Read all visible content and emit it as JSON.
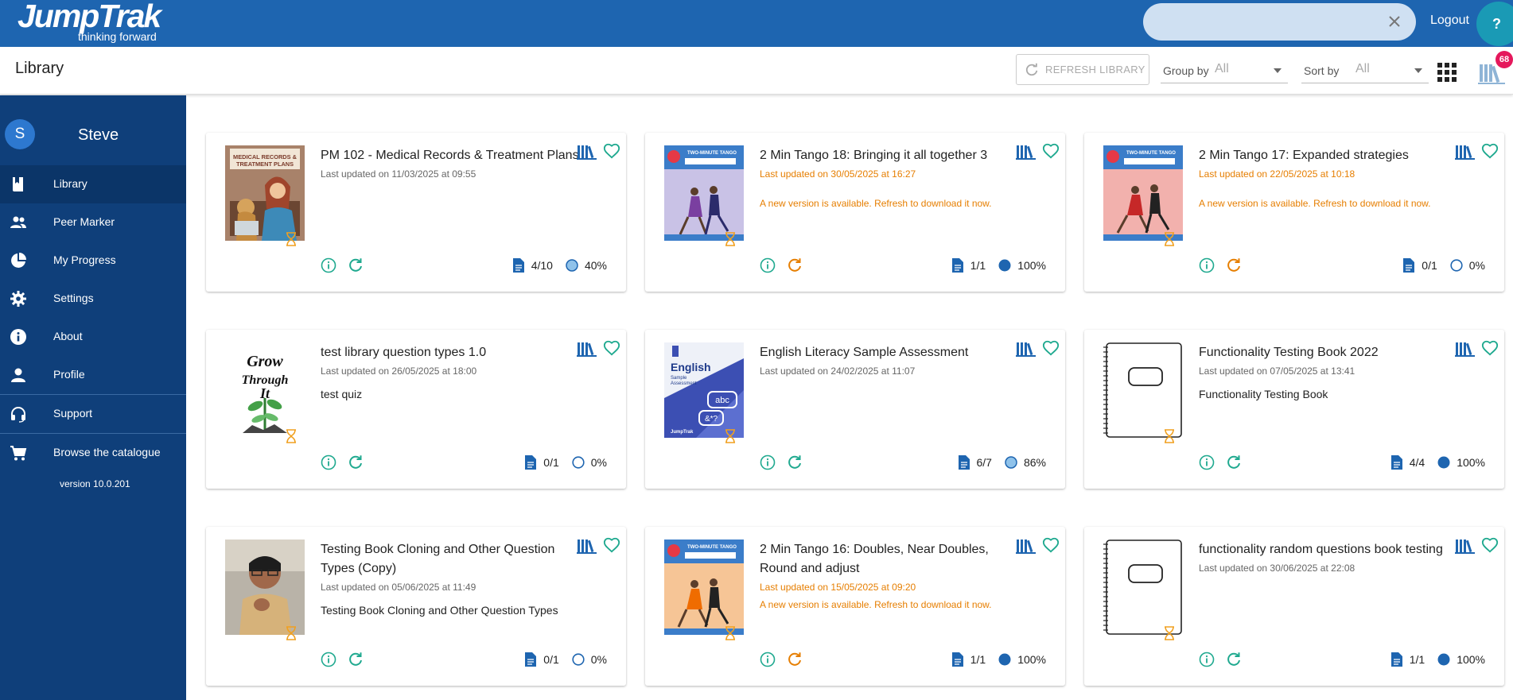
{
  "app": {
    "logo_main": "JumpTrak",
    "logo_sub": "thinking forward",
    "search_placeholder": "",
    "logout_label": "Logout",
    "help_label": "?"
  },
  "header": {
    "title": "Library",
    "refresh_label": "REFRESH LIBRARY",
    "group_by_label": "Group by",
    "group_by_value": "All",
    "sort_by_label": "Sort by",
    "sort_by_value": "All",
    "badge_count": "68"
  },
  "sidebar": {
    "avatar_initial": "S",
    "user_name": "Steve",
    "items": [
      {
        "label": "Library",
        "icon": "book-icon"
      },
      {
        "label": "Peer Marker",
        "icon": "people-icon"
      },
      {
        "label": "My Progress",
        "icon": "pie-chart-icon"
      },
      {
        "label": "Settings",
        "icon": "gear-icon"
      },
      {
        "label": "About",
        "icon": "info-icon"
      },
      {
        "label": "Profile",
        "icon": "person-icon"
      },
      {
        "label": "Support",
        "icon": "headset-icon"
      },
      {
        "label": "Browse the catalogue",
        "icon": "cart-icon"
      }
    ],
    "version": "version 10.0.201"
  },
  "colors": {
    "brand_blue": "#1e65b0",
    "sidebar_bg": "#0f3f7a",
    "accent_teal": "#1fa98f",
    "warning_orange": "#e67e00",
    "badge_pink": "#e5185c"
  },
  "cards": [
    {
      "title": "PM 102 - Medical Records & Treatment Plans",
      "date": "Last updated on 11/03/2025 at 09:55",
      "date_warning": false,
      "description": "",
      "new_version": "",
      "pages": "4/10",
      "progress": "40%",
      "progress_fraction": 0.4
    },
    {
      "title": "2 Min Tango 18: Bringing it all together 3",
      "date": "Last updated on 30/05/2025 at 16:27",
      "date_warning": true,
      "description": "",
      "new_version": "A new version is available. Refresh to download it now.",
      "pages": "1/1",
      "progress": "100%",
      "progress_fraction": 1.0
    },
    {
      "title": "2 Min Tango 17: Expanded strategies",
      "date": "Last updated on 22/05/2025 at 10:18",
      "date_warning": true,
      "description": "",
      "new_version": "A new version is available. Refresh to download it now.",
      "pages": "0/1",
      "progress": "0%",
      "progress_fraction": 0.0
    },
    {
      "title": "test library question types 1.0",
      "date": "Last updated on 26/05/2025 at 18:00",
      "date_warning": false,
      "description": "test quiz",
      "new_version": "",
      "pages": "0/1",
      "progress": "0%",
      "progress_fraction": 0.0
    },
    {
      "title": "English Literacy Sample Assessment",
      "date": "Last updated on 24/02/2025 at 11:07",
      "date_warning": false,
      "description": "",
      "new_version": "",
      "pages": "6/7",
      "progress": "86%",
      "progress_fraction": 0.86
    },
    {
      "title": "Functionality Testing Book 2022",
      "date": "Last updated on 07/05/2025 at 13:41",
      "date_warning": false,
      "description": "Functionality Testing Book",
      "new_version": "",
      "pages": "4/4",
      "progress": "100%",
      "progress_fraction": 1.0
    },
    {
      "title": "Testing Book Cloning and Other Question Types (Copy)",
      "date": "Last updated on 05/06/2025 at 11:49",
      "date_warning": false,
      "description": "Testing Book Cloning and Other Question Types",
      "new_version": "",
      "pages": "0/1",
      "progress": "0%",
      "progress_fraction": 0.0
    },
    {
      "title": "2 Min Tango 16: Doubles, Near Doubles, Round and adjust",
      "date": "Last updated on 15/05/2025 at 09:20",
      "date_warning": true,
      "description": "",
      "new_version": "A new version is available. Refresh to download it now.",
      "pages": "1/1",
      "progress": "100%",
      "progress_fraction": 1.0
    },
    {
      "title": "functionality random questions book testing",
      "date": "Last updated on 30/06/2025 at 22:08",
      "date_warning": false,
      "description": "",
      "new_version": "",
      "pages": "1/1",
      "progress": "100%",
      "progress_fraction": 1.0
    }
  ],
  "cover_texts": {
    "pm102": "MEDICAL RECORDS & TREATMENT PLANS",
    "tango": "TWO-MINUTE TANGO",
    "grow": "Grow Through It",
    "english": "English",
    "english_sub": "Sample Assessment",
    "english_bubble1": "abc",
    "english_bubble2": "&*?"
  }
}
